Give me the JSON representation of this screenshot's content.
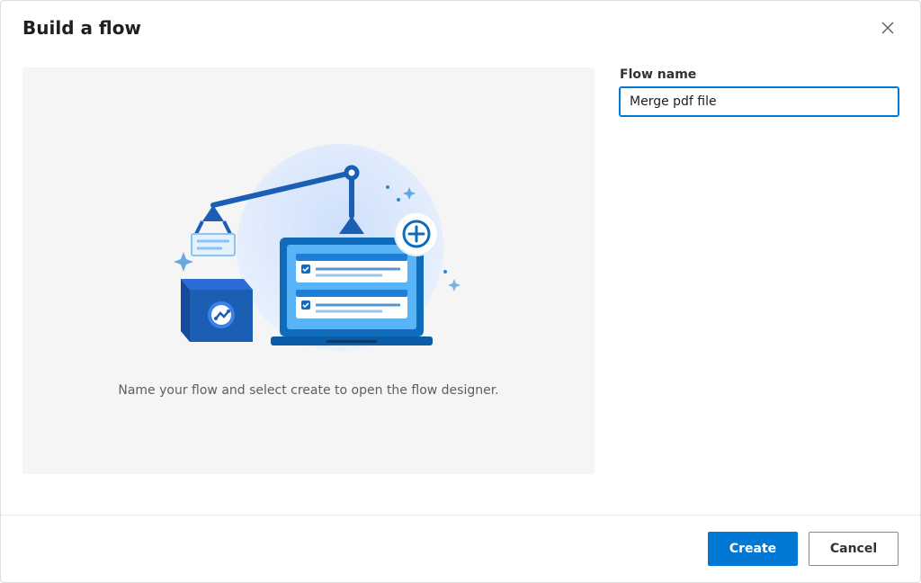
{
  "dialog": {
    "title": "Build a flow",
    "caption": "Name your flow and select create to open the flow designer."
  },
  "form": {
    "flow_name_label": "Flow name",
    "flow_name_value": "Merge pdf file"
  },
  "footer": {
    "create_label": "Create",
    "cancel_label": "Cancel"
  },
  "icons": {
    "close": "close-icon",
    "plus": "plus-icon"
  }
}
